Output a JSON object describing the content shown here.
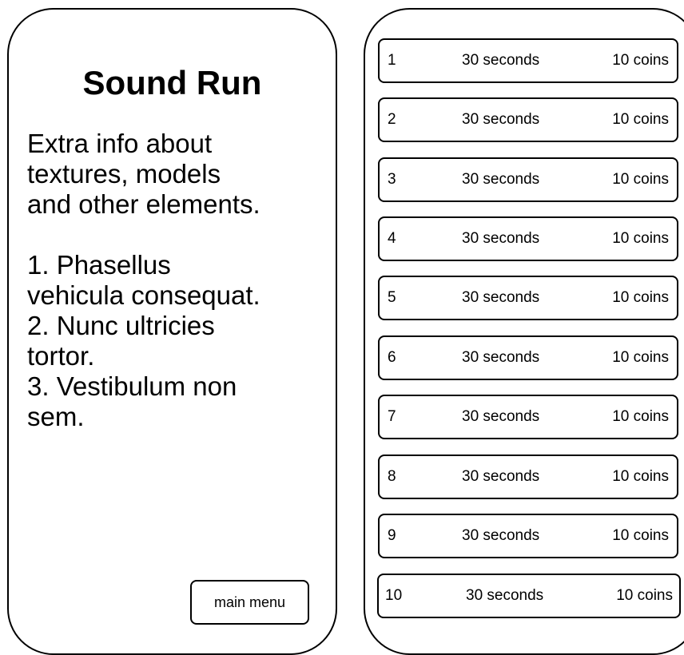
{
  "info_panel": {
    "title": "Sound Run",
    "description": "Extra info about\ntextures, models\nand other elements.\n\n1. Phasellus\nvehicula consequat.\n2. Nunc ultricies\ntortor.\n3. Vestibulum non\nsem.",
    "main_menu_label": "main menu"
  },
  "levels": [
    {
      "number": "1",
      "time": "30 seconds",
      "reward": "10 coins"
    },
    {
      "number": "2",
      "time": "30 seconds",
      "reward": "10 coins"
    },
    {
      "number": "3",
      "time": "30 seconds",
      "reward": "10 coins"
    },
    {
      "number": "4",
      "time": "30 seconds",
      "reward": "10 coins"
    },
    {
      "number": "5",
      "time": "30 seconds",
      "reward": "10 coins"
    },
    {
      "number": "6",
      "time": "30 seconds",
      "reward": "10 coins"
    },
    {
      "number": "7",
      "time": "30 seconds",
      "reward": "10 coins"
    },
    {
      "number": "8",
      "time": "30 seconds",
      "reward": "10 coins"
    },
    {
      "number": "9",
      "time": "30 seconds",
      "reward": "10 coins"
    },
    {
      "number": "10",
      "time": "30 seconds",
      "reward": "10 coins"
    }
  ]
}
